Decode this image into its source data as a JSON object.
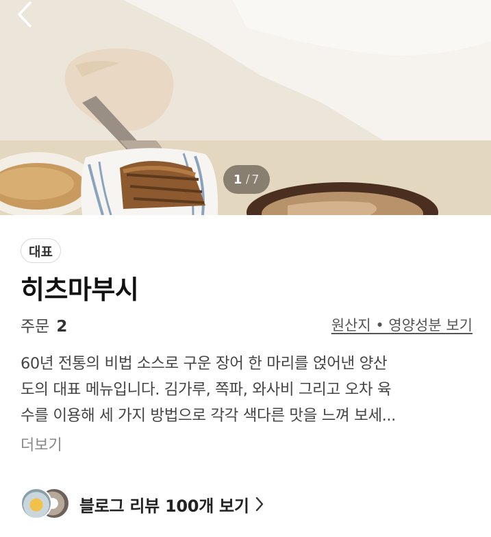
{
  "icons": {
    "back": "chevron-left-icon",
    "chevron_right": "chevron-right-icon"
  },
  "gallery": {
    "current": "1",
    "separator": "/",
    "total": "7"
  },
  "menu": {
    "badge": "대표",
    "name": "히츠마부시",
    "orders_label": "주문",
    "orders_count": "2",
    "origin_link": "원산지 • 영양성분 보기",
    "description_lines": [
      "60년 전통의 비법 소스로 구운 장어 한 마리를 얹어낸 양산",
      "도의 대표 메뉴입니다. 김가루, 쪽파, 와사비 그리고 오차 육",
      "수를 이용해 세 가지 방법으로 각각 색다른 맛을 느껴 보세..."
    ],
    "more_label": "더보기"
  },
  "blog": {
    "label": "블로그 리뷰 100개 보기"
  },
  "colors": {
    "badge_border": "#d8d8d8",
    "text_primary": "#111111",
    "text_secondary": "#444444",
    "text_muted": "#888888"
  }
}
